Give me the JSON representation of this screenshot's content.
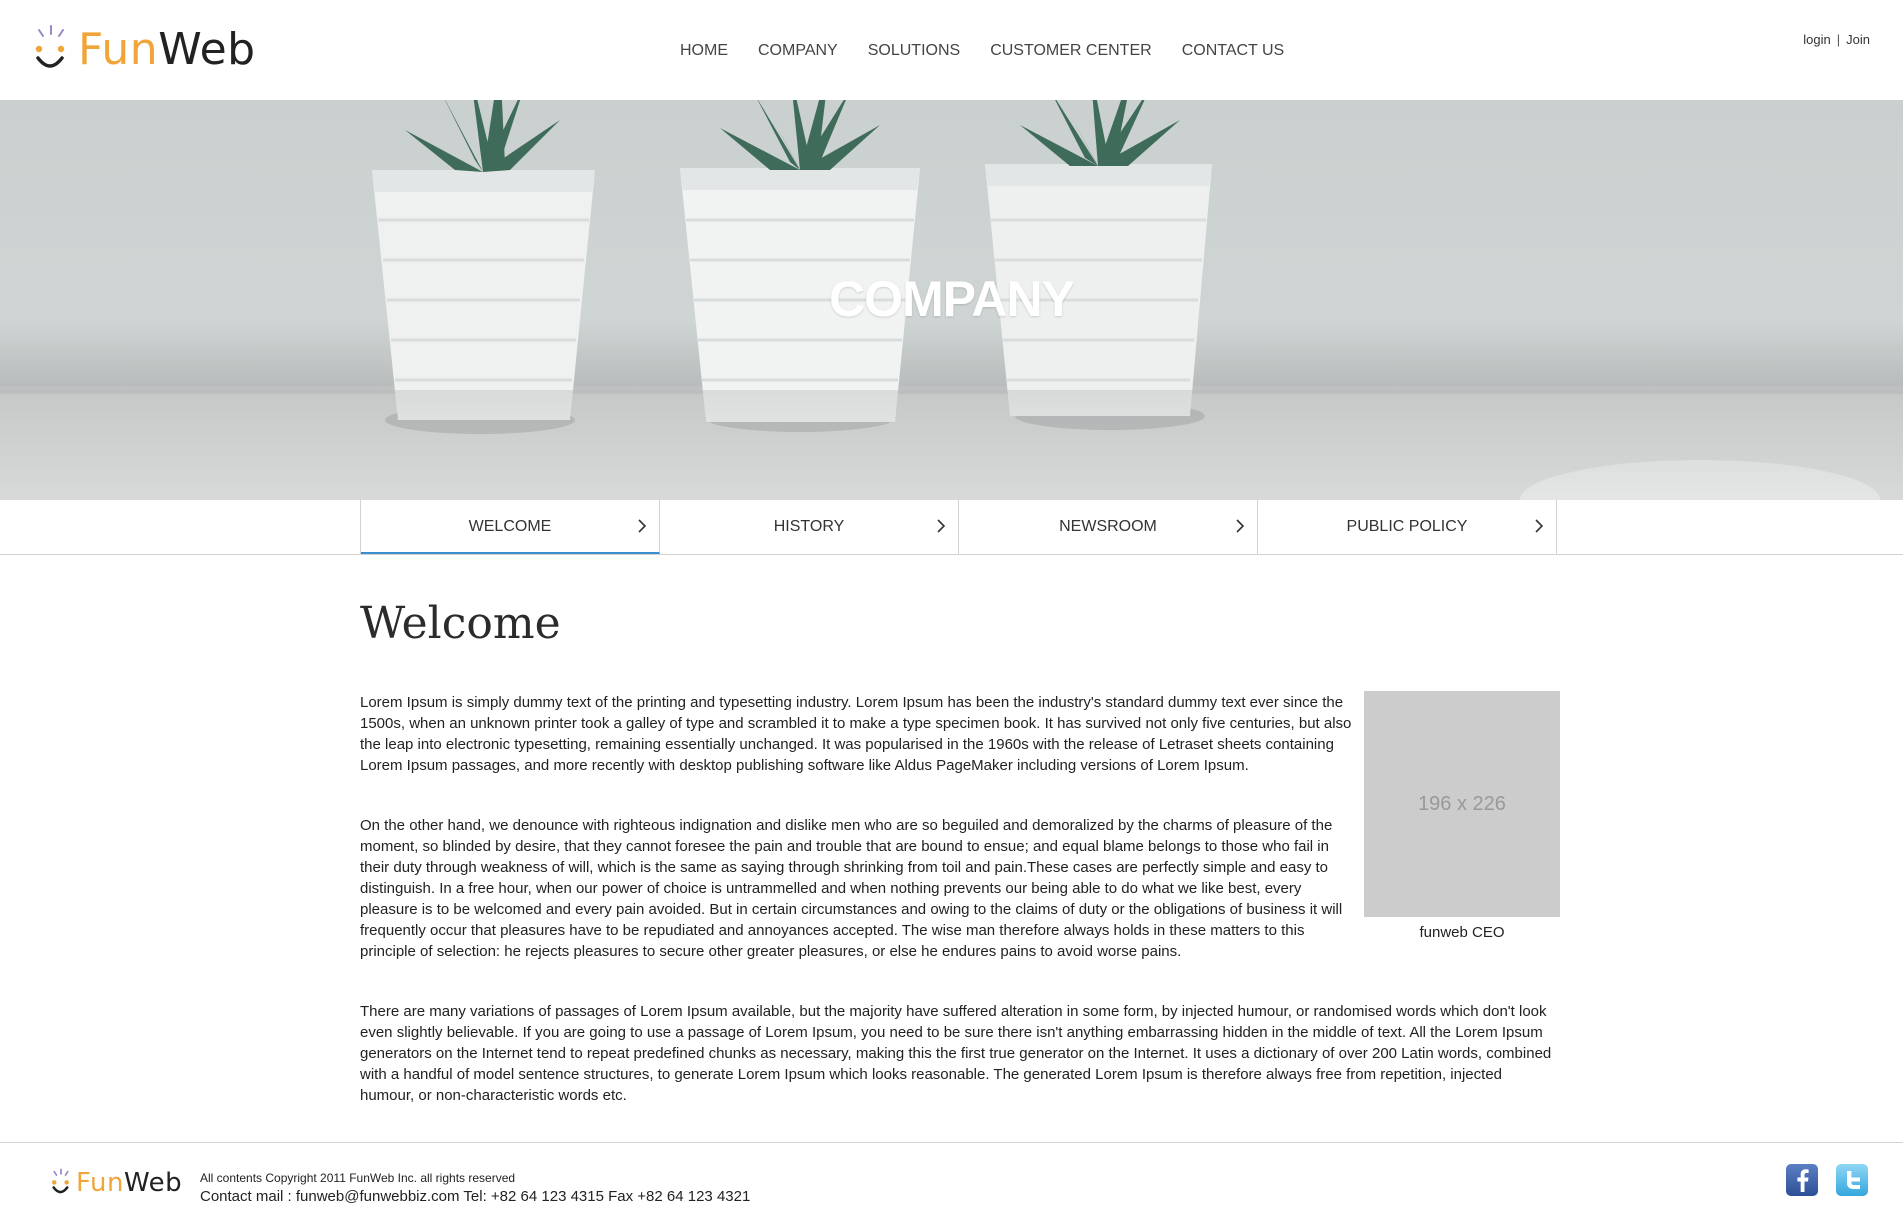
{
  "brand": {
    "part1": "Fun",
    "part2": "Web"
  },
  "nav": {
    "items": [
      "HOME",
      "COMPANY",
      "SOLUTIONS",
      "CUSTOMER CENTER",
      "CONTACT US"
    ]
  },
  "member": {
    "login": "login",
    "separator": "|",
    "join": "Join"
  },
  "hero": {
    "title": "COMPANY"
  },
  "subnav": {
    "tabs": [
      "WELCOME",
      "HISTORY",
      "NEWSROOM",
      "PUBLIC POLICY"
    ],
    "active": "WELCOME"
  },
  "content": {
    "title": "Welcome",
    "paragraphs": [
      "Lorem Ipsum is simply dummy text of the printing and typesetting industry. Lorem Ipsum has been the industry's standard dummy text ever since the 1500s, when an unknown printer took a galley of type and scrambled it to make a type specimen book. It has survived not only five centuries, but also the leap into electronic typesetting, remaining essentially unchanged. It was popularised in the 1960s with the release of Letraset sheets containing Lorem Ipsum passages, and more recently with desktop publishing software like Aldus PageMaker including versions of Lorem Ipsum.",
      "On the other hand, we denounce with righteous indignation and dislike men who are so beguiled and demoralized by the charms of pleasure of the moment, so blinded by desire, that they cannot foresee the pain and trouble that are bound to ensue; and equal blame belongs to those who fail in their duty through weakness of will, which is the same as saying through shrinking from toil and pain.These cases are perfectly simple and easy to distinguish. In a free hour, when our power of choice is untrammelled and when nothing prevents our being able to do what we like best, every pleasure is to be welcomed and every pain avoided. But in certain circumstances and owing to the claims of duty or the obligations of business it will frequently occur that pleasures have to be repudiated and annoyances accepted. The wise man therefore always holds in these matters to this principle of selection: he rejects pleasures to secure other greater pleasures, or else he endures pains to avoid worse pains.",
      "There are many variations of passages of Lorem Ipsum available, but the majority have suffered alteration in some form, by injected humour, or randomised words which don't look even slightly believable. If you are going to use a passage of Lorem Ipsum, you need to be sure there isn't anything embarrassing hidden in the middle of text. All the Lorem Ipsum generators on the Internet tend to repeat predefined chunks as necessary, making this the first true generator on the Internet. It uses a dictionary of over 200 Latin words, combined with a handful of model sentence structures, to generate Lorem Ipsum which looks reasonable. The generated Lorem Ipsum is therefore always free from repetition, injected humour, or non-characteristic words etc."
    ],
    "image_placeholder": "196 x 226",
    "image_caption": "funweb CEO"
  },
  "footer": {
    "copyright": "All contents Copyright 2011 FunWeb Inc. all rights reserved",
    "contact": "Contact mail : funweb@funwebbiz.com Tel: +82 64 123 4315 Fax +82 64 123 4321",
    "social_icons": [
      "facebook-icon",
      "twitter-icon"
    ]
  },
  "colors": {
    "brand_orange": "#f0a53a",
    "active_tab_underline": "#3a8fd0"
  }
}
